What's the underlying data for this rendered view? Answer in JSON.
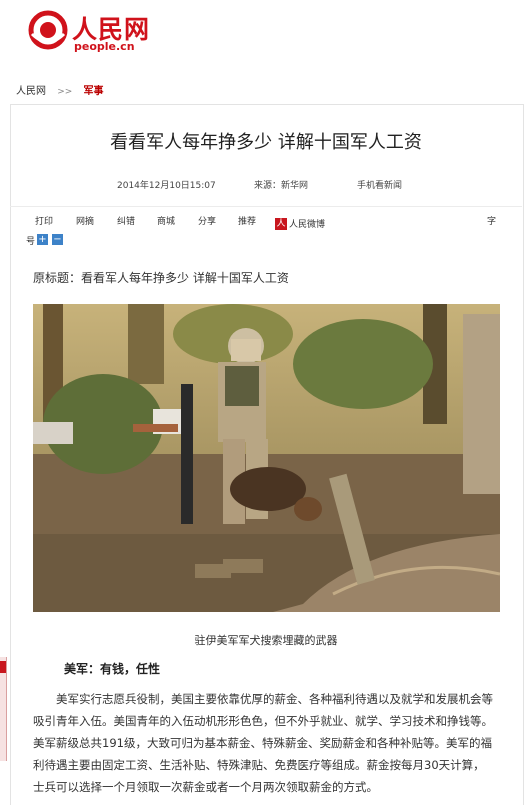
{
  "header": {
    "logo_cn": "人民网",
    "logo_en": "people.cn"
  },
  "breadcrumb": {
    "home": "人民网",
    "sep": ">>",
    "section": "军事"
  },
  "article": {
    "title": "看看军人每年挣多少 详解十国军人工资",
    "date": "2014年12月10日15:07",
    "source": "来源：新华网",
    "mobile": "手机看新闻",
    "original_title": "原标题：看看军人每年挣多少  详解十国军人工资",
    "photo_alt": "Soldier with rifle and military dog searching a palm grove",
    "caption": "驻伊美军军犬搜索埋藏的武器",
    "subhead": "美军：有钱，任性",
    "body": "美军实行志愿兵役制，美国主要依靠优厚的薪金、各种福利待遇以及就学和发展机会等吸引青年入伍。美国青年的入伍动机形形色色，但不外乎就业、就学、学习技术和挣钱等。美军薪级总共191级，大致可归为基本薪金、特殊薪金、奖励薪金和各种补贴等。美军的福利待遇主要由固定工资、生活补贴、特殊津贴、免费医疗等组成。薪金按每月30天计算，士兵可以选择一个月领取一次薪金或者一个月两次领取薪金的方式。"
  },
  "toolbar": {
    "print": "打印",
    "web_hot": "网摘",
    "error": "纠错",
    "share_mall": "商城",
    "share": "分享",
    "recommend": "推荐",
    "weibo_badge": "人",
    "weibo": "人民微博",
    "font_size_1": "字",
    "font_size_2": "号",
    "plus": "+",
    "minus": "−"
  },
  "colors": {
    "brand_red": "#d0121b",
    "accent_blue": "#3d82c8"
  }
}
